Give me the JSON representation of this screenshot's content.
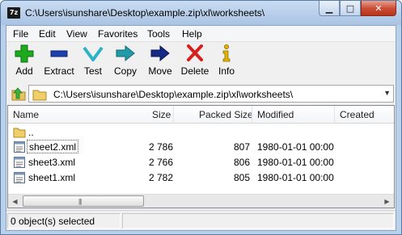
{
  "window": {
    "app_icon_text": "7z",
    "title": "C:\\Users\\isunshare\\Desktop\\example.zip\\xl\\worksheets\\",
    "minimize_glyph": "▁",
    "maximize_glyph": "□",
    "close_glyph": "✕"
  },
  "menu": [
    "File",
    "Edit",
    "View",
    "Favorites",
    "Tools",
    "Help"
  ],
  "toolbar": {
    "add": "Add",
    "extract": "Extract",
    "test": "Test",
    "copy": "Copy",
    "move": "Move",
    "delete": "Delete",
    "info": "Info"
  },
  "address": {
    "path": "C:\\Users\\isunshare\\Desktop\\example.zip\\xl\\worksheets\\",
    "dropdown_glyph": "▼"
  },
  "columns": {
    "name": "Name",
    "size": "Size",
    "packed_size": "Packed Size",
    "modified": "Modified",
    "created": "Created"
  },
  "parent_row": {
    "name": ".."
  },
  "files": [
    {
      "name": "sheet2.xml",
      "size": "2 786",
      "packed_size": "807",
      "modified": "1980-01-01 00:00"
    },
    {
      "name": "sheet3.xml",
      "size": "2 766",
      "packed_size": "806",
      "modified": "1980-01-01 00:00"
    },
    {
      "name": "sheet1.xml",
      "size": "2 782",
      "packed_size": "805",
      "modified": "1980-01-01 00:00"
    }
  ],
  "scrollbar": {
    "left_arrow": "◀",
    "right_arrow": "▶",
    "grip": "|||"
  },
  "status": {
    "selection": "0 object(s) selected"
  },
  "colors": {
    "add_icon": "#1fa91f",
    "extract_icon": "#1e3fb0",
    "test_icon": "#2ab3c8",
    "copy_icon": "#239aa8",
    "move_icon": "#142a86",
    "delete_icon": "#d62020",
    "info_icon": "#e4b400"
  }
}
